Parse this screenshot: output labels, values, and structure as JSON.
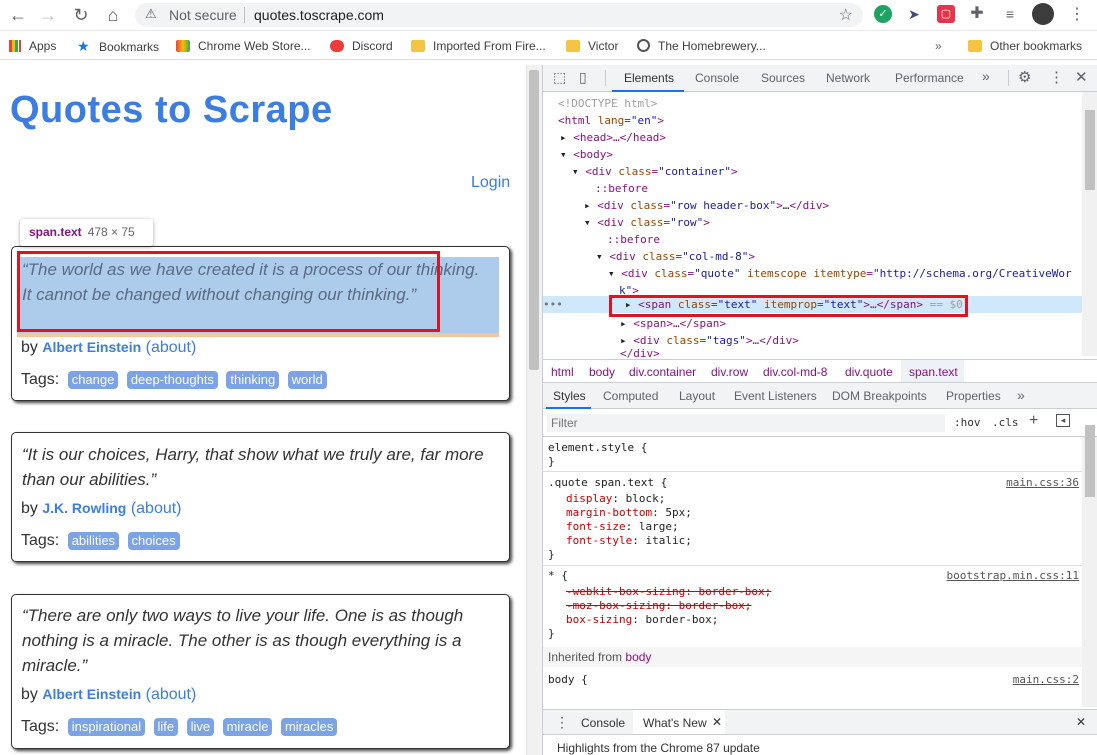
{
  "browser": {
    "security": "Not secure",
    "url": "quotes.toscrape.com"
  },
  "bookmarks": [
    {
      "label": "Apps",
      "icon": "apps-grid-icon"
    },
    {
      "label": "Bookmarks",
      "icon": "star-icon"
    },
    {
      "label": "Chrome Web Store...",
      "icon": "web-store-icon"
    },
    {
      "label": "Discord",
      "icon": "discord-icon"
    },
    {
      "label": "Imported From Fire...",
      "icon": "folder-icon"
    },
    {
      "label": "Victor",
      "icon": "folder-icon"
    },
    {
      "label": "The Homebrewery...",
      "icon": "homebrewery-icon"
    },
    {
      "label": "Other bookmarks",
      "icon": "folder-icon"
    }
  ],
  "site": {
    "title": "Quotes to Scrape",
    "login": "Login"
  },
  "tooltip": {
    "tag": "span.text",
    "dims": "478 × 75"
  },
  "quotes": [
    {
      "text": "“The world as we have created it is a process of our thinking. It cannot be changed without changing our thinking.”",
      "by": "by",
      "author": "Albert Einstein",
      "about": "(about)",
      "tags_label": "Tags:",
      "tags": [
        "change",
        "deep-thoughts",
        "thinking",
        "world"
      ]
    },
    {
      "text": "“It is our choices, Harry, that show what we truly are, far more than our abilities.”",
      "by": "by",
      "author": "J.K. Rowling",
      "about": "(about)",
      "tags_label": "Tags:",
      "tags": [
        "abilities",
        "choices"
      ]
    },
    {
      "text": "“There are only two ways to live your life. One is as though nothing is a miracle. The other is as though everything is a miracle.”",
      "by": "by",
      "author": "Albert Einstein",
      "about": "(about)",
      "tags_label": "Tags:",
      "tags": [
        "inspirational",
        "life",
        "live",
        "miracle",
        "miracles"
      ]
    }
  ],
  "devtools": {
    "tabs": [
      "Elements",
      "Console",
      "Sources",
      "Network",
      "Performance",
      "»"
    ],
    "dom": {
      "doctype": "<!DOCTYPE html>",
      "html_open": "<html ",
      "html_attr": "lang",
      "html_val": "\"en\"",
      "head": "<head>…</head>",
      "body": "<body>",
      "div": "<div ",
      "div_close": "</div>",
      "attr_class": "class",
      "val_container": "\"container\"",
      "before": "::before",
      "val_header": "\"row header-box\"",
      "ellipsis": "…",
      "val_row": "\"row\"",
      "val_col": "\"col-md-8\"",
      "val_quote": "\"quote\"",
      "attr_itemscope": "itemscope",
      "attr_itemtype": "itemtype",
      "val_itemtype": "\"http://schema.org/CreativeWor",
      "val_itemtype_wrap": "k\"",
      "gt": ">",
      "span_open": "<span ",
      "val_text": "\"text\"",
      "attr_itemprop": "itemprop",
      "span_close": "…</span>",
      "sel_marker": "== $0",
      "span_collapsed": "<span>…</span>",
      "val_tags": "\"tags\"",
      "div_collapsed": ">…</div>",
      "div_end": "</div>",
      "dots": "•••"
    },
    "crumbs": [
      "html",
      "body",
      "div.container",
      "div.row",
      "div.col-md-8",
      "div.quote",
      "span.text"
    ],
    "subtabs": [
      "Styles",
      "Computed",
      "Layout",
      "Event Listeners",
      "DOM Breakpoints",
      "Properties",
      "»"
    ],
    "filter_placeholder": "Filter",
    "hov": ":hov",
    "cls": ".cls",
    "styles": {
      "element_style": "element.style {",
      "close": "}",
      "rule1_selector": ".quote span.text {",
      "rule1_src": "main.css:36",
      "rule1_props": [
        {
          "name": "display",
          "value": "block;"
        },
        {
          "name": "margin-bottom",
          "value": "5px;"
        },
        {
          "name": "font-size",
          "value": "large;"
        },
        {
          "name": "font-style",
          "value": "italic;"
        }
      ],
      "rule2_selector": "* {",
      "rule2_src": "bootstrap.min.css:11",
      "rule2_strike1": "-webkit-box-sizing: border-box;",
      "rule2_strike2": "-moz-box-sizing: border-box;",
      "rule2_prop": "box-sizing",
      "rule2_val": "border-box;",
      "inherited_label": "Inherited from",
      "inherited_from": "body",
      "rule3_selector": "body {",
      "rule3_src": "main.css:2"
    },
    "drawer": {
      "tabs": [
        "Console",
        "What's New"
      ],
      "body": "Highlights from the Chrome 87 update"
    }
  }
}
